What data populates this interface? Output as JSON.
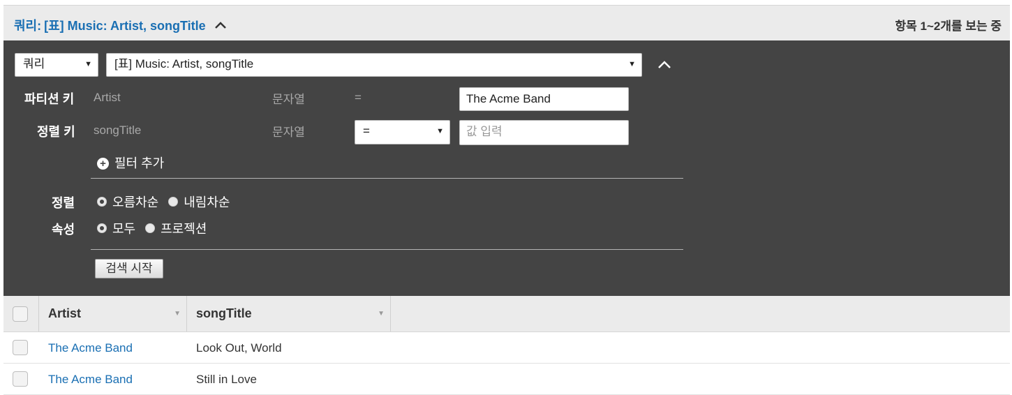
{
  "header": {
    "title_prefix": "쿼리:",
    "title_table": "[표] Music: Artist, songTitle",
    "item_count": "항목 1~2개를 보는 중"
  },
  "query": {
    "mode_value": "쿼리",
    "table_value": "[표] Music: Artist, songTitle",
    "partition_key": {
      "label": "파티션 키",
      "attribute": "Artist",
      "type": "문자열",
      "operator": "=",
      "value": "The Acme Band"
    },
    "sort_key": {
      "label": "정렬 키",
      "attribute": "songTitle",
      "type": "문자열",
      "operator": "=",
      "placeholder": "값 입력"
    },
    "add_filter_label": "필터 추가",
    "sort": {
      "label": "정렬",
      "options": [
        "오름차순",
        "내림차순"
      ],
      "selected": "오름차순"
    },
    "attributes": {
      "label": "속성",
      "options": [
        "모두",
        "프로젝션"
      ],
      "selected": "모두"
    },
    "start_search_label": "검색 시작"
  },
  "results": {
    "columns": [
      "Artist",
      "songTitle"
    ],
    "rows": [
      {
        "artist": "The Acme Band",
        "song_title": "Look Out, World"
      },
      {
        "artist": "The Acme Band",
        "song_title": "Still in Love"
      }
    ]
  }
}
